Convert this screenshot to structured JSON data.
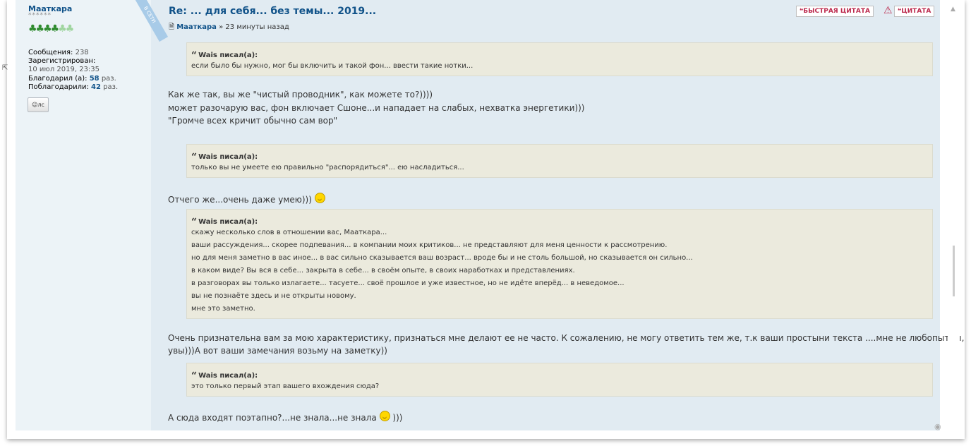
{
  "post": {
    "title": "Re: ... для себя... без темы... 2019...",
    "author": "Маaткара",
    "byline_sep": "»",
    "time_ago": "23 минуты назад",
    "quick_quote": "БЫСТРАЯ ЦИТАТА",
    "quote_btn": "ЦИТАТА"
  },
  "profile": {
    "username": "Маaткара",
    "stars": "******",
    "online_label": "В СЕТИ",
    "messages_label": "Сообщения:",
    "messages": "238",
    "registered_label": "Зарегистрирован:",
    "registered": "10 июл 2019, 23:35",
    "thanked_label": "Благодарил (а):",
    "thanked": "58",
    "thanked_suffix": "раз.",
    "was_thanked_label": "Поблагодарили:",
    "was_thanked": "42",
    "was_thanked_suffix": "раз.",
    "pm_label": "лс"
  },
  "quotes": [
    {
      "cite": "Wais писал(а):",
      "lines": [
        "если было бы нужно, мог бы включить и такой фон... ввести такие нотки..."
      ]
    },
    {
      "cite": "Wais писал(а):",
      "lines": [
        "только вы не умеете ею правильно \"распорядиться\"... ею насладиться..."
      ]
    },
    {
      "cite": "Wais писал(а):",
      "lines": [
        "скажу несколько слов в отношении вас, Маaткара...",
        "ваши рассуждения... скорее подпевания... в компании моих критиков... не представляют для меня ценности к рассмотрению.",
        "но для меня заметно в вас иное... в вас сильно сказывается ваш возраст... вроде бы и не столь большой, но сказывается он сильно...",
        "в каком виде? Вы вся в себе... закрыта в себе... в своём опыте, в своих наработках и представлениях.",
        "в разговорах вы только излагаете... тасуете... своё прошлое и уже известное, но не идёте вперёд... в неведомое...",
        "вы не познаёте здесь и не открыты новому.",
        "мне это заметно."
      ]
    },
    {
      "cite": "Wais писал(а):",
      "lines": [
        "это только первый этап вашего вхождения сюда?"
      ]
    }
  ],
  "paragraphs": {
    "p1": [
      "Как же так, вы же \"чистый проводник\", как можете то?))))",
      "может разочарую вас, фон включает Сшоне...и нападает на слабых, нехватка энергетики)))",
      "\"Громче всех кричит обычно сам вор\""
    ],
    "p2": "Отчего же...очень даже умею)))",
    "p3": [
      "Очень признательна вам за мою характеристику, признаться мне делают ее не часто. К сожалению, не могу ответить тем же, т.к ваши простыни текста ....мне не любопытны,",
      "увы)))А вот ваши замечания возьму на заметку))"
    ],
    "p4a": "А сюда входят поэтапно?...не знала...не знала",
    "p4b": ")))"
  },
  "colors": {
    "link": "#105289",
    "panel": "#e1ebf2",
    "quote_bg": "#ebeadd",
    "button_text": "#bc2a4d"
  }
}
